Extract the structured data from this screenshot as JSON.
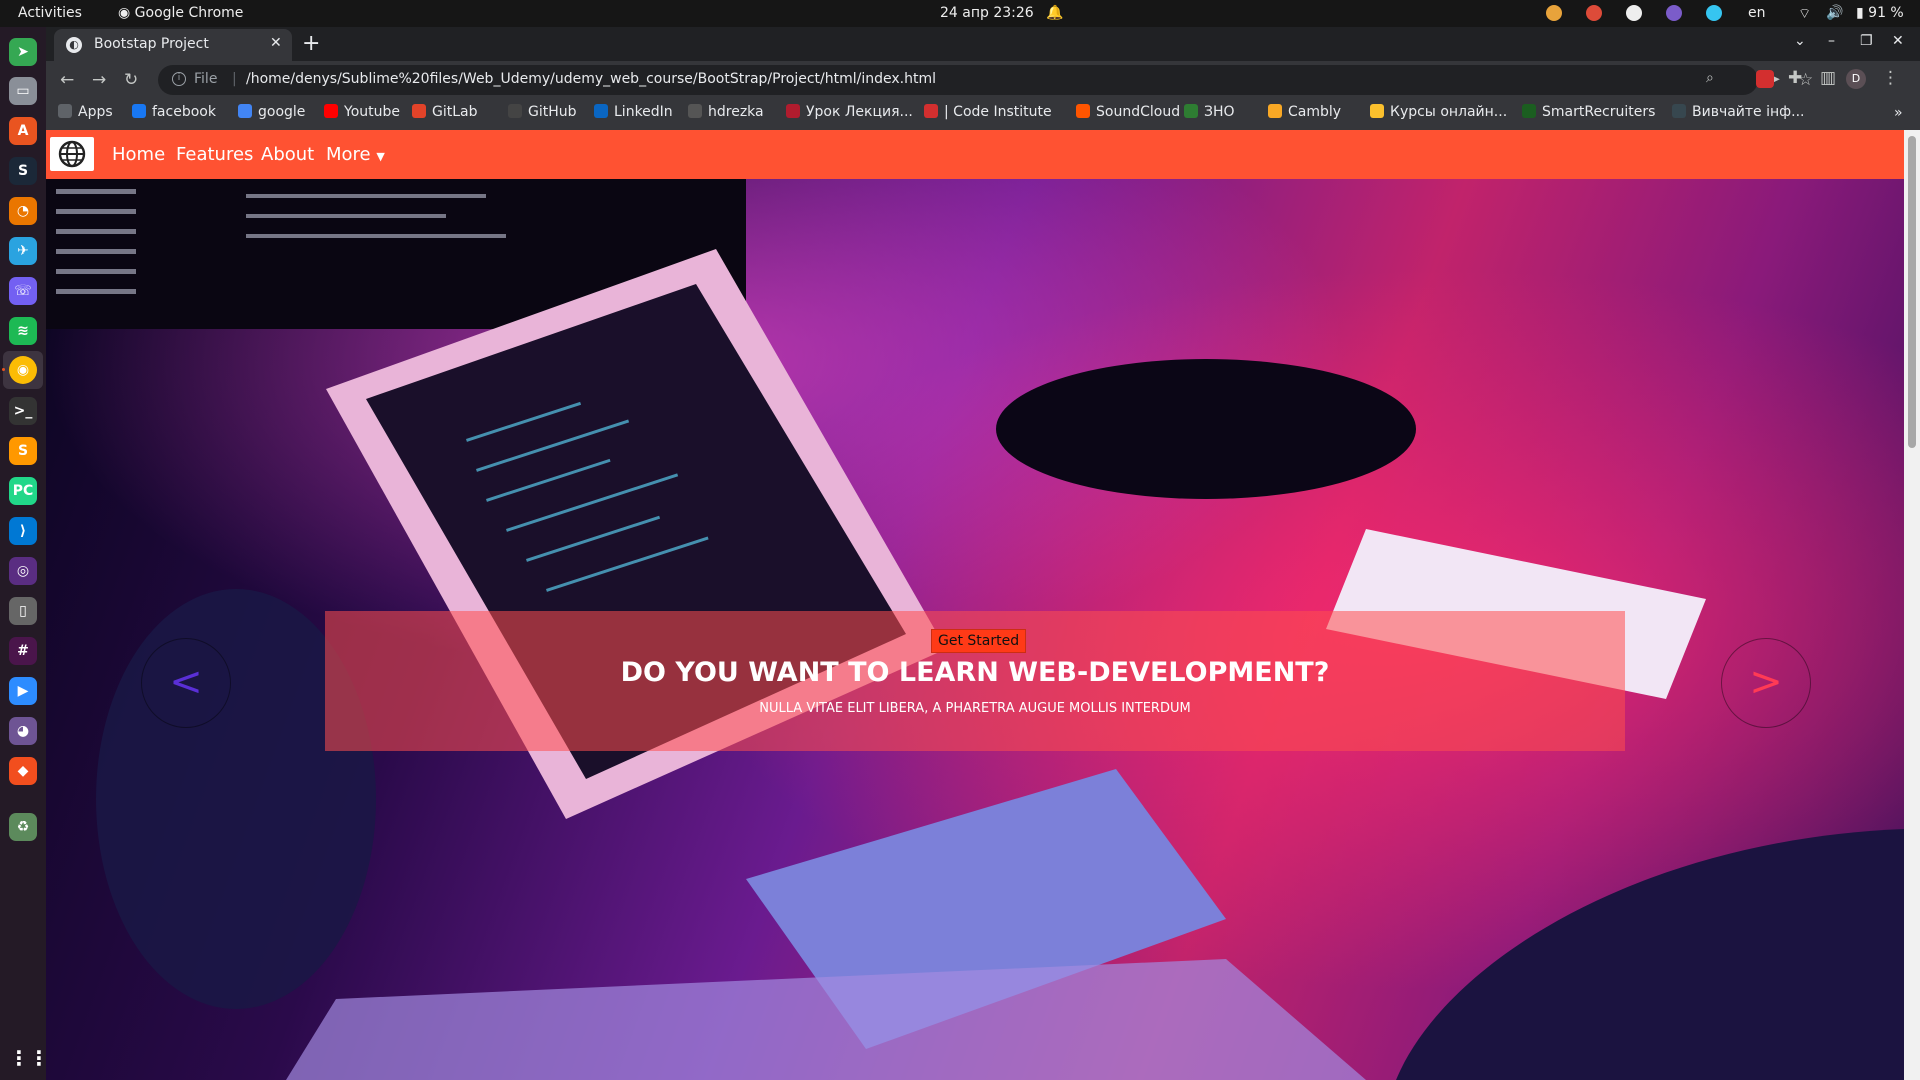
{
  "os_bar": {
    "activities": "Activities",
    "app_name": "Google Chrome",
    "clock": "24 апр  23:26",
    "lang": "en",
    "battery": "91 %"
  },
  "browser": {
    "tab_title": "Bootstap Project",
    "url_scheme": "File",
    "url": "/home/denys/Sublime%20files/Web_Udemy/udemy_web_course/BootStrap/Project/html/index.html",
    "profile_initial": "D"
  },
  "bookmarks": [
    {
      "label": "Apps",
      "icon": "apps-grid-icon",
      "color": "#5f6368"
    },
    {
      "label": "facebook",
      "icon": "facebook-icon",
      "color": "#1877f2"
    },
    {
      "label": "google",
      "icon": "google-icon",
      "color": "#4285f4"
    },
    {
      "label": "Youtube",
      "icon": "youtube-icon",
      "color": "#ff0000"
    },
    {
      "label": "GitLab",
      "icon": "gitlab-icon",
      "color": "#e24329"
    },
    {
      "label": "GitHub",
      "icon": "github-icon",
      "color": "#444444"
    },
    {
      "label": "LinkedIn",
      "icon": "linkedin-icon",
      "color": "#0a66c2"
    },
    {
      "label": "hdrezka",
      "icon": "hdrezka-icon",
      "color": "#555555"
    },
    {
      "label": "Урок Лекция...",
      "icon": "lecture-icon",
      "color": "#b01c2e"
    },
    {
      "label": "| Code Institute",
      "icon": "code-institute-icon",
      "color": "#d32f2f"
    },
    {
      "label": "SoundCloud",
      "icon": "soundcloud-icon",
      "color": "#ff5500"
    },
    {
      "label": "ЗНО",
      "icon": "zno-icon",
      "color": "#2e7d32"
    },
    {
      "label": "Cambly",
      "icon": "cambly-icon",
      "color": "#f9a825"
    },
    {
      "label": "Курсы онлайн...",
      "icon": "courses-icon",
      "color": "#fbc02d"
    },
    {
      "label": "SmartRecruiters",
      "icon": "smartrecruiters-icon",
      "color": "#1b5e20"
    },
    {
      "label": "Вивчайте інф...",
      "icon": "learn-icon",
      "color": "#37474f"
    }
  ],
  "site": {
    "nav": {
      "home": "Home",
      "features": "Features",
      "about": "About",
      "more": "More"
    },
    "hero": {
      "cta": "Get Started",
      "headline": "DO YOU WANT TO LEARN WEB-DEVELOPMENT?",
      "subtext": "NULLA VITAE ELIT LIBERA, A PHARETRA AUGUE MOLLIS INTERDUM",
      "prev": "<",
      "next": ">"
    },
    "colors": {
      "navbar": "#ff5232",
      "caption_bg": "#ff4f4f",
      "arrows": "#ff3a55"
    }
  }
}
